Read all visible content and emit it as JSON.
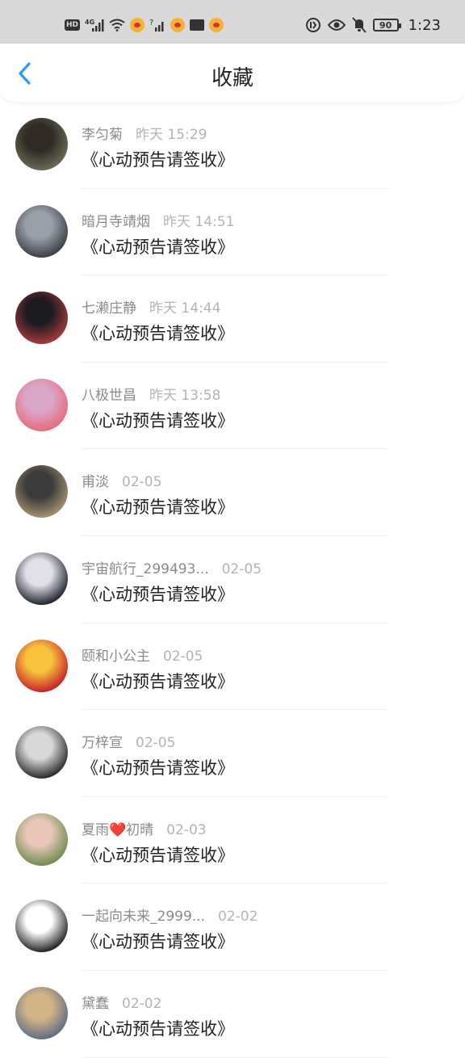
{
  "status_bar": {
    "left_icons": [
      "hd-icon",
      "signal-4g-icon",
      "wifi-icon",
      "weibo-icon",
      "signal-icon",
      "weibo-icon",
      "mail-icon",
      "weibo-icon"
    ],
    "hd_label": "HD",
    "net_label": "4G",
    "battery": "90",
    "time": "1:23"
  },
  "header": {
    "title": "收藏"
  },
  "favorites": [
    {
      "name": "李匀菊",
      "time": "昨天 15:29",
      "message": "《心动预告请签收》"
    },
    {
      "name": "暗月寺靖烟",
      "time": "昨天 14:51",
      "message": "《心动预告请签收》"
    },
    {
      "name": "七濑庄静",
      "time": "昨天 14:44",
      "message": "《心动预告请签收》"
    },
    {
      "name": "八极世昌",
      "time": "昨天 13:58",
      "message": "《心动预告请签收》"
    },
    {
      "name": "甫淡",
      "time": "02-05",
      "message": "《心动预告请签收》"
    },
    {
      "name": "宇宙航行_299493...",
      "time": "02-05",
      "message": "《心动预告请签收》"
    },
    {
      "name": "颐和小公主",
      "time": "02-05",
      "message": "《心动预告请签收》"
    },
    {
      "name": "万梓宣",
      "time": "02-05",
      "message": "《心动预告请签收》"
    },
    {
      "name": "夏雨❤️初晴",
      "time": "02-03",
      "message": "《心动预告请签收》"
    },
    {
      "name": "一起向未来_2999...",
      "time": "02-02",
      "message": "《心动预告请签收》"
    },
    {
      "name": "黛蠢",
      "time": "02-02",
      "message": "《心动预告请签收》"
    }
  ],
  "colors": {
    "accent": "#2b9cf0",
    "status_bar_bg": "#d9d9d9",
    "name_text": "#8a8a8a",
    "time_text": "#b3b3b3",
    "avatars": [
      [
        "#2f2a24",
        "#6a6b55"
      ],
      [
        "#9aa0a8",
        "#3b3f48"
      ],
      [
        "#1d1b22",
        "#a33a3a"
      ],
      [
        "#d9a8c8",
        "#e86a7a"
      ],
      [
        "#3a3a3a",
        "#a4916f"
      ],
      [
        "#e0e0e6",
        "#1f2230"
      ],
      [
        "#f6c33b",
        "#c8202a"
      ],
      [
        "#d8d8d8",
        "#2b2b2b"
      ],
      [
        "#e8c6b8",
        "#6e8d4e"
      ],
      [
        "#ffffff",
        "#222222"
      ],
      [
        "#d2b486",
        "#5d6e86"
      ]
    ]
  }
}
